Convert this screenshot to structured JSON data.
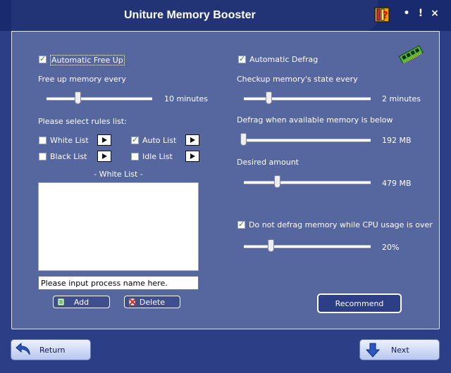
{
  "window": {
    "title": "Uniture Memory Booster",
    "minimize_label": "•",
    "help_label": "!",
    "close_label": "×"
  },
  "left": {
    "auto_free": {
      "label": "Automatic Free Up",
      "checked": true
    },
    "free_every": {
      "label": "Free up memory every",
      "value_text": "10 minutes",
      "level": 0.2
    },
    "rules_label": "Please select rules list:",
    "rules": [
      {
        "label": "White List",
        "checked": false
      },
      {
        "label": "Auto List",
        "checked": true
      },
      {
        "label": "Black List",
        "checked": false
      },
      {
        "label": "Idle List",
        "checked": false
      }
    ],
    "list_title": "- White List -",
    "process_input": {
      "value": "Please input process name here."
    },
    "add_label": "Add",
    "delete_label": "Delete"
  },
  "right": {
    "auto_defrag": {
      "label": "Automatic Defrag",
      "checked": true
    },
    "checkup": {
      "label": "Checkup memory's state every",
      "value_text": "2 minutes",
      "level": 0.1
    },
    "defrag_below": {
      "label": "Defrag when available memory is below",
      "value_text": "192 MB",
      "level": 0.0
    },
    "desired": {
      "label": "Desired amount",
      "value_text": "479 MB",
      "level": 0.25
    },
    "cpu": {
      "label": "Do not defrag memory while CPU usage is over",
      "checked": true,
      "value_text": "20%",
      "level": 0.2
    },
    "recommend_label": "Recommend"
  },
  "footer": {
    "return_label": "Return",
    "next_label": "Next"
  },
  "colors": {
    "background": "#2c3f86",
    "panel": "#56669e",
    "titlebar": "#1a2a6e"
  }
}
